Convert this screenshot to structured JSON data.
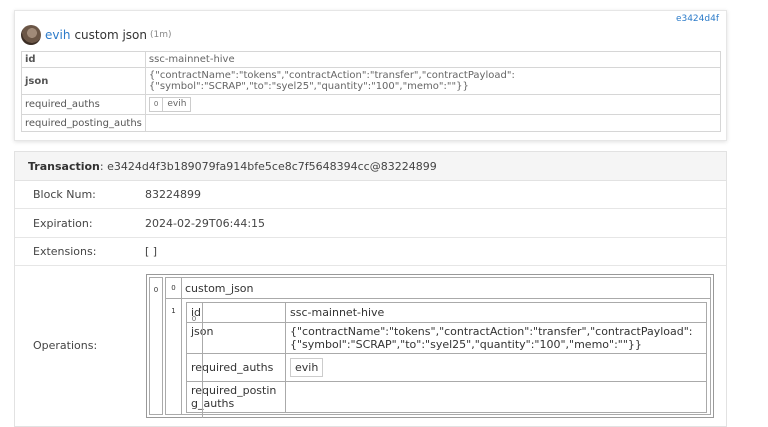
{
  "card": {
    "hash": "e3424d4f",
    "user": "evih",
    "op_name": "custom json",
    "ago": "(1m)",
    "rows": {
      "id_key": "id",
      "id_val": "ssc-mainnet-hive",
      "json_key": "json",
      "json_val": "{\"contractName\":\"tokens\",\"contractAction\":\"transfer\",\"contractPayload\":{\"symbol\":\"SCRAP\",\"to\":\"syel25\",\"quantity\":\"100\",\"memo\":\"\"}}",
      "req_auths_key": "required_auths",
      "req_auths_index": "0",
      "req_auths_val": "evih",
      "req_posting_key": "required_posting_auths"
    }
  },
  "transaction": {
    "label": "Transaction",
    "value": ": e3424d4f3b189079fa914bfe5ce8c7f5648394cc@83224899",
    "block_num_key": "Block Num:",
    "block_num_val": "83224899",
    "expiration_key": "Expiration:",
    "expiration_val": "2024-02-29T06:44:15",
    "extensions_key": "Extensions:",
    "extensions_val": "[ ]",
    "operations_key": "Operations:",
    "operations": {
      "outer_index": "0",
      "type_index": "0",
      "type": "custom_json",
      "body_index": "1",
      "id_key": "id",
      "id_val": "ssc-mainnet-hive",
      "json_key": "json",
      "json_val": "{\"contractName\":\"tokens\",\"contractAction\":\"transfer\",\"contractPayload\":{\"symbol\":\"SCRAP\",\"to\":\"syel25\",\"quantity\":\"100\",\"memo\":\"\"}}",
      "req_auths_key": "required_auths",
      "req_auths_index": "0",
      "req_auths_val": "evih",
      "req_posting_key": "required_posting_auths"
    }
  }
}
